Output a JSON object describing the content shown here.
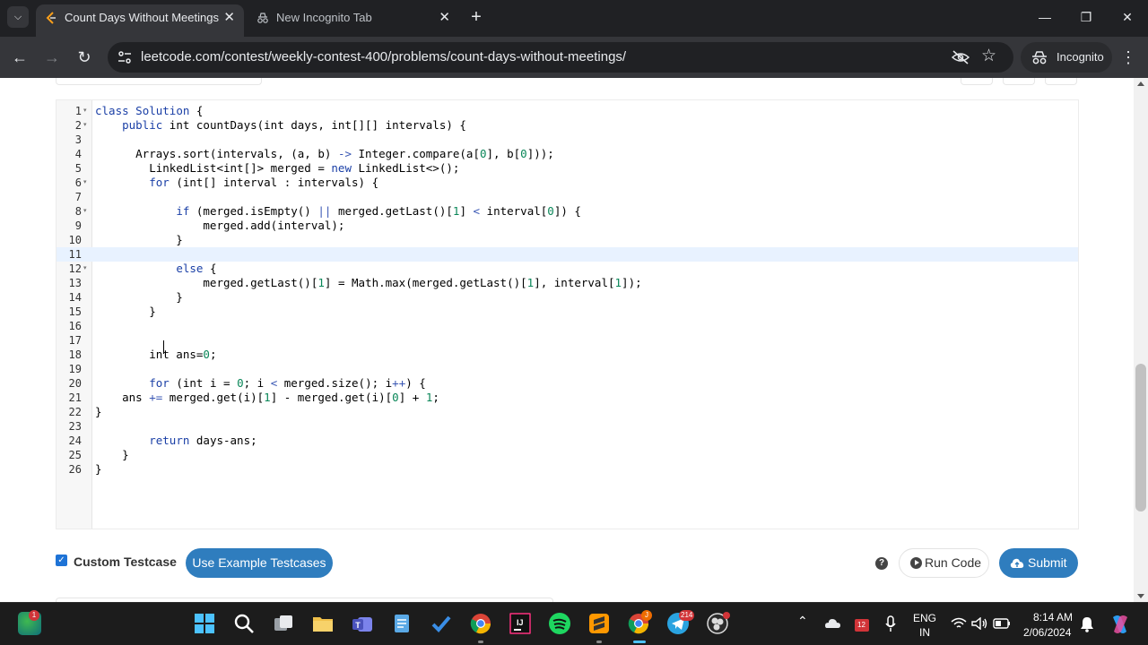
{
  "browser": {
    "tabs": [
      {
        "title": "Count Days Without Meetings",
        "active": true
      },
      {
        "title": "New Incognito Tab",
        "active": false
      }
    ],
    "url": "leetcode.com/contest/weekly-contest-400/problems/count-days-without-meetings/",
    "profile_label": "Incognito"
  },
  "editor": {
    "language": "java",
    "current_line": 11,
    "fold_lines": [
      1,
      2,
      6,
      8,
      12
    ],
    "lines": [
      "class Solution {",
      "    public int countDays(int days, int[][] intervals) {",
      "",
      "      Arrays.sort(intervals, (a, b) -> Integer.compare(a[0], b[0]));",
      "        LinkedList<int[]> merged = new LinkedList<>();",
      "        for (int[] interval : intervals) {",
      "",
      "            if (merged.isEmpty() || merged.getLast()[1] < interval[0]) {",
      "                merged.add(interval);",
      "            }",
      "",
      "            else {",
      "                merged.getLast()[1] = Math.max(merged.getLast()[1], interval[1]);",
      "            }",
      "        }",
      "",
      "",
      "        int ans=0;",
      "",
      "        for (int i = 0; i < merged.size(); i++) {",
      "    ans += merged.get(i)[1] - merged.get(i)[0] + 1;",
      "}",
      "",
      "        return days-ans;",
      "    }",
      "}"
    ]
  },
  "controls": {
    "custom_testcase_label": "Custom Testcase",
    "custom_testcase_checked": true,
    "use_example_label": "Use Example Testcases",
    "help_icon": "?",
    "run_code_label": "Run Code",
    "submit_label": "Submit"
  },
  "taskbar": {
    "weather_badge": "1",
    "chrome_badge": "J",
    "telegram_badge": "214",
    "calendar_badge": "12",
    "lang_top": "ENG",
    "lang_bottom": "IN",
    "time": "8:14 AM",
    "date": "2/06/2024"
  },
  "colors": {
    "chrome_dark": "#202124",
    "chrome_mid": "#35363a",
    "accent_blue": "#2f7dbe",
    "current_line": "#e8f2ff"
  }
}
